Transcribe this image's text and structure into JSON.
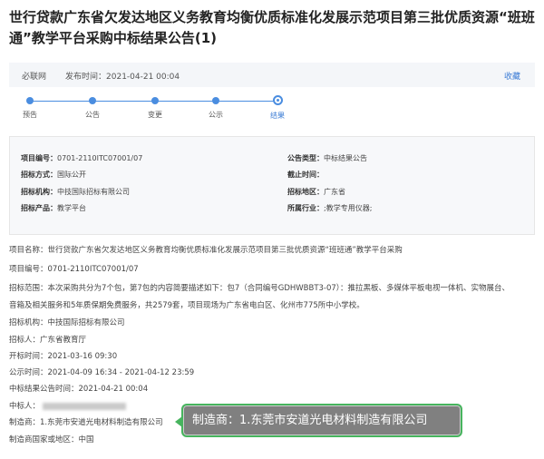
{
  "title": "世行贷款广东省欠发达地区义务教育均衡优质标准化发展示范项目第三批优质资源“班班通”教学平台采购中标结果公告(1)",
  "meta": {
    "source": "必联网",
    "publish_label": "发布时间：",
    "publish_time": "2021-04-21 00:04",
    "favorite": "收藏"
  },
  "steps": [
    "预告",
    "公告",
    "变更",
    "公示",
    "结果"
  ],
  "info": {
    "project_no_label": "项目编号：",
    "project_no": "0701-2110ITC07001/07",
    "notice_type_label": "公告类型：",
    "notice_type": "中标结果公告",
    "method_label": "招标方式：",
    "method": "国际公开",
    "deadline_label": "截止时间：",
    "deadline": "",
    "agency_label": "招标机构：",
    "agency": "中技国际招标有限公司",
    "region_label": "招标地区：",
    "region": "广东省",
    "product_label": "招标产品：",
    "product": "教学平台",
    "industry_label": "所属行业：",
    "industry": ";教学专用仪器;"
  },
  "body": {
    "l1": "项目名称：世行贷款广东省欠发达地区义务教育均衡优质标准化发展示范项目第三批优质资源“班班通”教学平台采购",
    "l2": "项目编号：0701-2110ITC07001/07",
    "l3": "招标范围：本次采购共分为7个包，第7包的内容简要描述如下：包7（合同编号GDHWBBT3-07）：推拉黑板、多媒体平板电视一体机、实物展台、",
    "l4": "音箱及相关服务和5年质保期免费服务，共2579套，项目现场为广东省电白区、化州市775所中小学校。",
    "l5": "招标机构：中技国际招标有限公司",
    "l6": "招标人：广东省教育厅",
    "l7": "开标时间：2021-03-16 09:30",
    "l8": "公示时间：2021-04-09 16:34 - 2021-04-12 23:59",
    "l9": "中标结果公告时间：2021-04-21 00:04",
    "l10": "中标人：",
    "l11": "制造商：1.东莞市安道光电材料制造有限公司",
    "l12": "制造商国家或地区：中国"
  },
  "callout": "制造商：1.东莞市安道光电材料制造有限公司",
  "colors": {
    "accent": "#3a7bd5",
    "callout_border": "#47b45e"
  }
}
